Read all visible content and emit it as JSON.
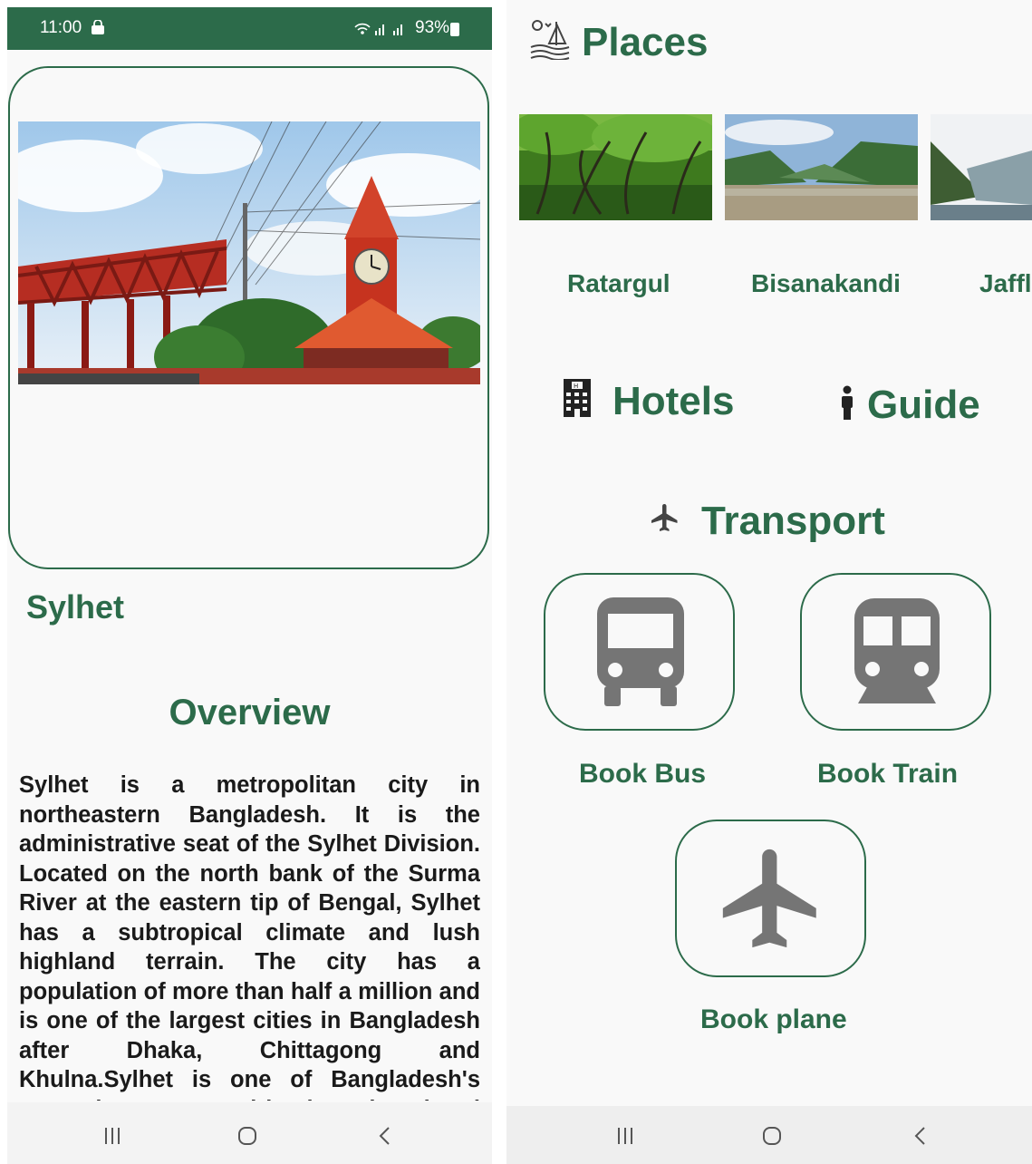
{
  "left": {
    "status_bar": {
      "time": "11:00",
      "battery": "93%"
    },
    "city_name": "Sylhet",
    "overview_title": "Overview",
    "overview_text": "Sylhet is a metropolitan city in northeastern Bangladesh. It is the administrative seat of the Sylhet Division. Located on the north bank of the Surma River at the eastern tip of Bengal, Sylhet has a subtropical climate and lush highland terrain. The city has a population of more than half a million and is one of the largest cities in Bangladesh after Dhaka, Chittagong and Khulna.Sylhet is one of Bangladesh's most important spiritual and cultural centres. Furthermore, it is one of the most economically important cities after"
  },
  "right": {
    "places_title": "Places",
    "places": [
      {
        "label": "Ratargul"
      },
      {
        "label": "Bisanakandi"
      },
      {
        "label": "Jaffl"
      }
    ],
    "hotels_title": "Hotels",
    "guide_title": "Guide",
    "transport_title": "Transport",
    "transport_options": [
      {
        "label": "Book Bus",
        "icon": "bus-icon"
      },
      {
        "label": "Book Train",
        "icon": "train-icon"
      },
      {
        "label": "Book plane",
        "icon": "airplane-icon"
      }
    ]
  },
  "colors": {
    "primary": "#2c6b4a",
    "icon_gray": "#757575",
    "text": "#1a1a1a"
  }
}
